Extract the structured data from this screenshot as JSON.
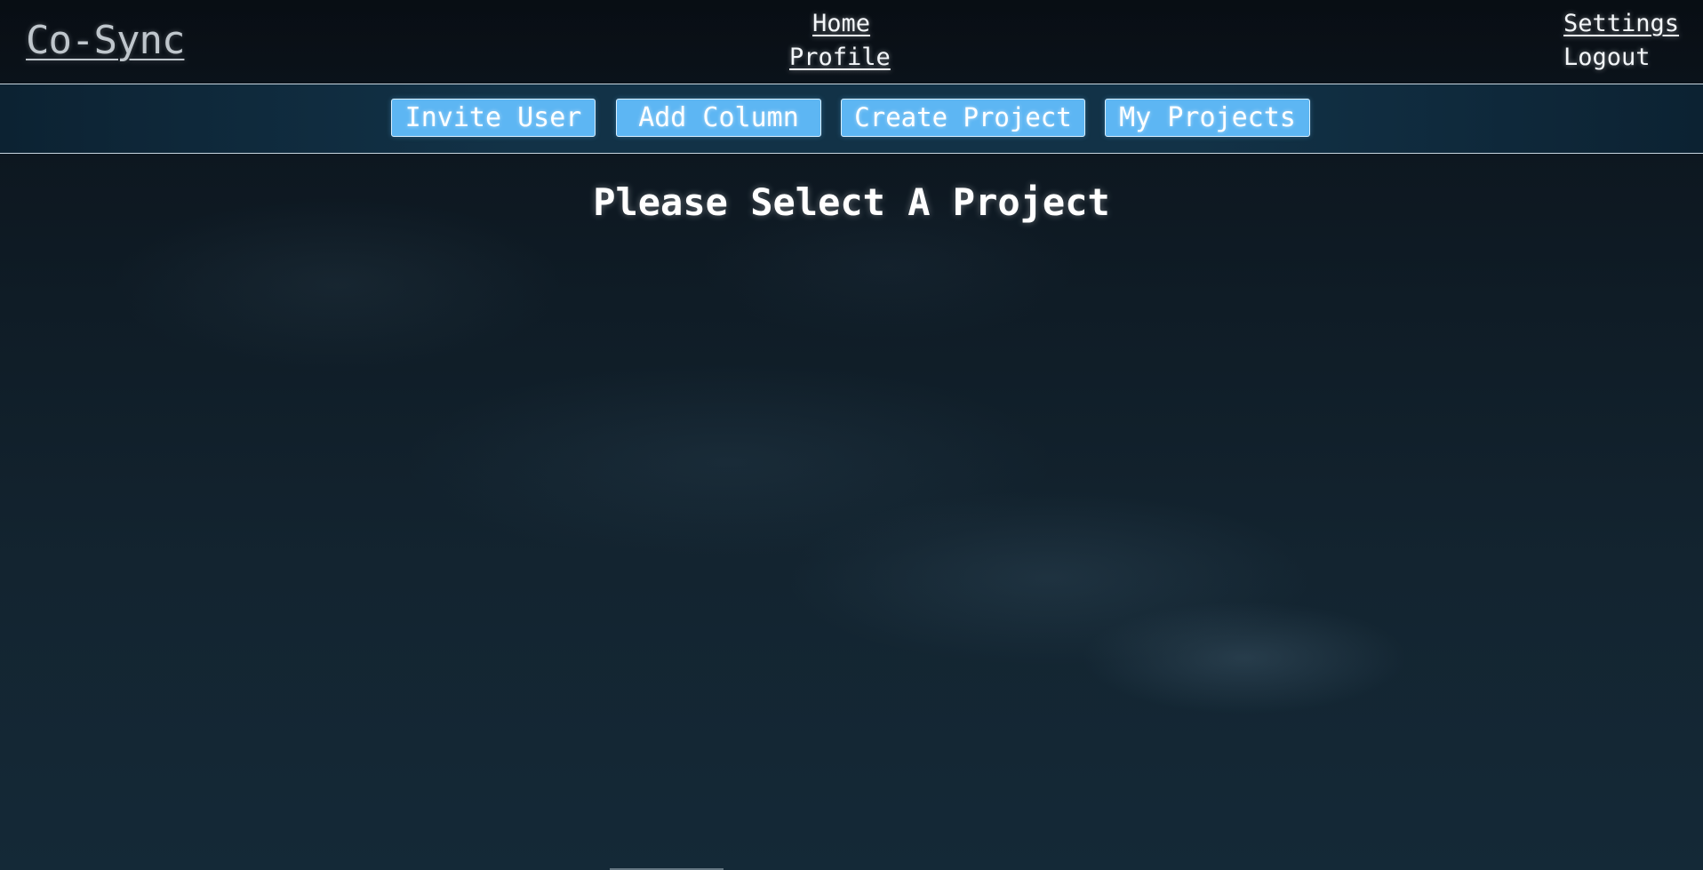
{
  "header": {
    "brand": "Co-Sync",
    "nav": {
      "home": "Home",
      "profile": "Profile",
      "settings": "Settings",
      "logout": "Logout"
    }
  },
  "toolbar": {
    "buttons": [
      {
        "label": "Invite User"
      },
      {
        "label": "Add Column"
      },
      {
        "label": "Create Project"
      },
      {
        "label": "My Projects"
      }
    ],
    "button_color": "#5db6f3"
  },
  "main": {
    "heading": "Please Select A Project"
  },
  "theme": {
    "background": "#0f1c26",
    "text": "#ffffff",
    "brand_text": "#bfc6cc"
  }
}
